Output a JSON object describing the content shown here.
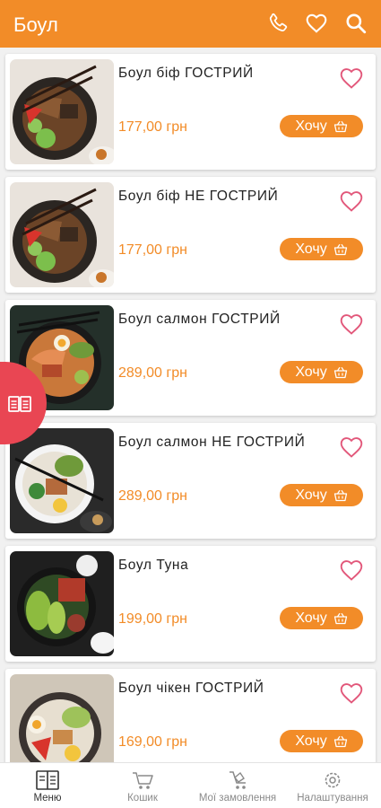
{
  "app_bar": {
    "title": "Боул",
    "icons": [
      "phone-icon",
      "heart-icon",
      "search-icon"
    ]
  },
  "products": [
    {
      "name": "Боул біф ГОСТРИЙ",
      "price": "177,00 грн",
      "button": "Хочу"
    },
    {
      "name": "Боул біф НЕ ГОСТРИЙ",
      "price": "177,00 грн",
      "button": "Хочу"
    },
    {
      "name": "Боул салмон ГОСТРИЙ",
      "price": "289,00 грн",
      "button": "Хочу"
    },
    {
      "name": "Боул салмон НЕ ГОСТРИЙ",
      "price": "289,00 грн",
      "button": "Хочу"
    },
    {
      "name": "Боул Туна",
      "price": "199,00 грн",
      "button": "Хочу"
    },
    {
      "name": "Боул чікен ГОСТРИЙ",
      "price": "169,00 грн",
      "button": "Хочу"
    }
  ],
  "side_tab": {
    "icon": "book-icon"
  },
  "bottom_nav": [
    {
      "label": "Меню",
      "icon": "menu-book-icon",
      "active": true
    },
    {
      "label": "Кошик",
      "icon": "cart-icon",
      "active": false
    },
    {
      "label": "Мої замовлення",
      "icon": "orders-icon",
      "active": false
    },
    {
      "label": "Налаштування",
      "icon": "settings-icon",
      "active": false
    }
  ],
  "colors": {
    "accent": "#f28c28",
    "favorite": "#e2577a",
    "side_tab": "#e94653",
    "background": "#f1f1f1"
  }
}
